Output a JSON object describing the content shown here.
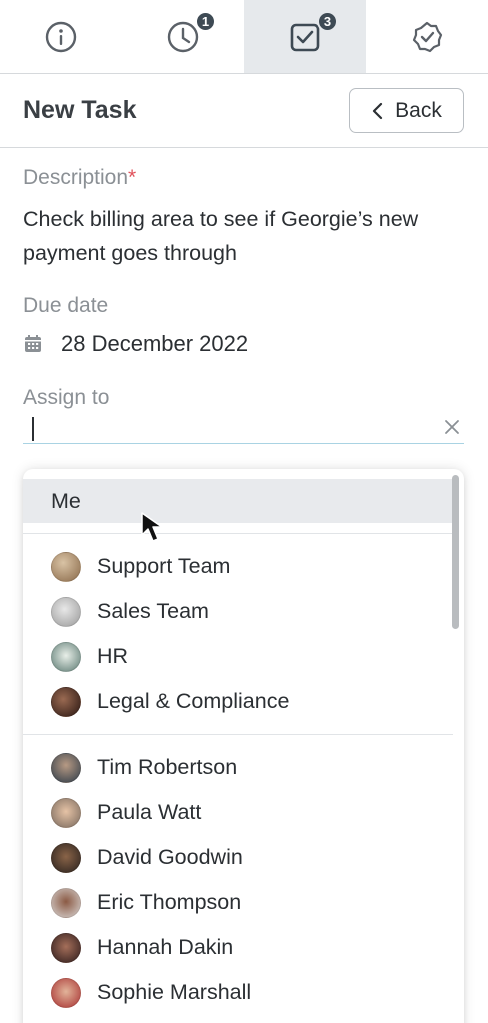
{
  "tabs": [
    {
      "icon": "info-icon",
      "badge": ""
    },
    {
      "icon": "clock-icon",
      "badge": "1"
    },
    {
      "icon": "task-check-icon",
      "badge": "3",
      "active": true
    },
    {
      "icon": "verified-check-icon",
      "badge": ""
    }
  ],
  "header": {
    "title": "New Task",
    "back_label": "Back"
  },
  "form": {
    "description_label": "Description",
    "required_mark": "*",
    "description_value": "Check billing area to see if Georgie’s new payment goes through",
    "due_date_label": "Due date",
    "due_date_value": "28 December 2022",
    "assign_label": "Assign to",
    "assign_value": ""
  },
  "dropdown": {
    "me_label": "Me",
    "teams": [
      {
        "name": "Support Team",
        "color": "#8a6a4a"
      },
      {
        "name": "Sales Team",
        "color": "#9a9a9a"
      },
      {
        "name": "HR",
        "color": "#5d7b73"
      },
      {
        "name": "Legal & Compliance",
        "color": "#4a2c22"
      }
    ],
    "people": [
      {
        "name": "Tim Robertson",
        "color": "#3c4a56"
      },
      {
        "name": "Paula Watt",
        "color": "#a88d7a"
      },
      {
        "name": "David Goodwin",
        "color": "#5a4030"
      },
      {
        "name": "Eric Thompson",
        "color": "#6e4a3a"
      },
      {
        "name": "Hannah Dakin",
        "color": "#4a2e2e"
      },
      {
        "name": "Sophie Marshall",
        "color": "#b84040"
      }
    ]
  },
  "colors": {
    "accent_badge": "#3e4a54",
    "active_tab": "#e6e9ec",
    "required": "#e0525b",
    "input_underline": "#a9d3e3"
  }
}
